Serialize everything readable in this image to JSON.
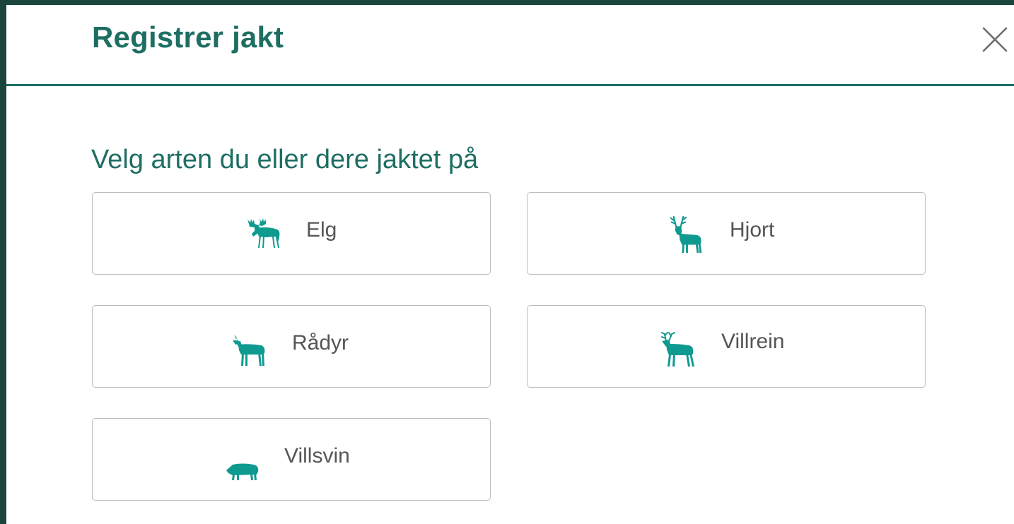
{
  "modal": {
    "title": "Registrer jakt",
    "close_icon": "close-icon"
  },
  "main": {
    "subtitle": "Velg arten du eller dere jaktet på",
    "species": [
      {
        "label": "Elg",
        "icon": "moose-icon"
      },
      {
        "label": "Hjort",
        "icon": "red-deer-icon"
      },
      {
        "label": "Rådyr",
        "icon": "roe-deer-icon"
      },
      {
        "label": "Villrein",
        "icon": "reindeer-icon"
      },
      {
        "label": "Villsvin",
        "icon": "wild-boar-icon"
      }
    ]
  },
  "colors": {
    "accent": "#1e6e63",
    "icon": "#0f9a90",
    "backdrop": "#1a453c",
    "button_border": "#bcbcbc",
    "button_text": "#555555"
  }
}
